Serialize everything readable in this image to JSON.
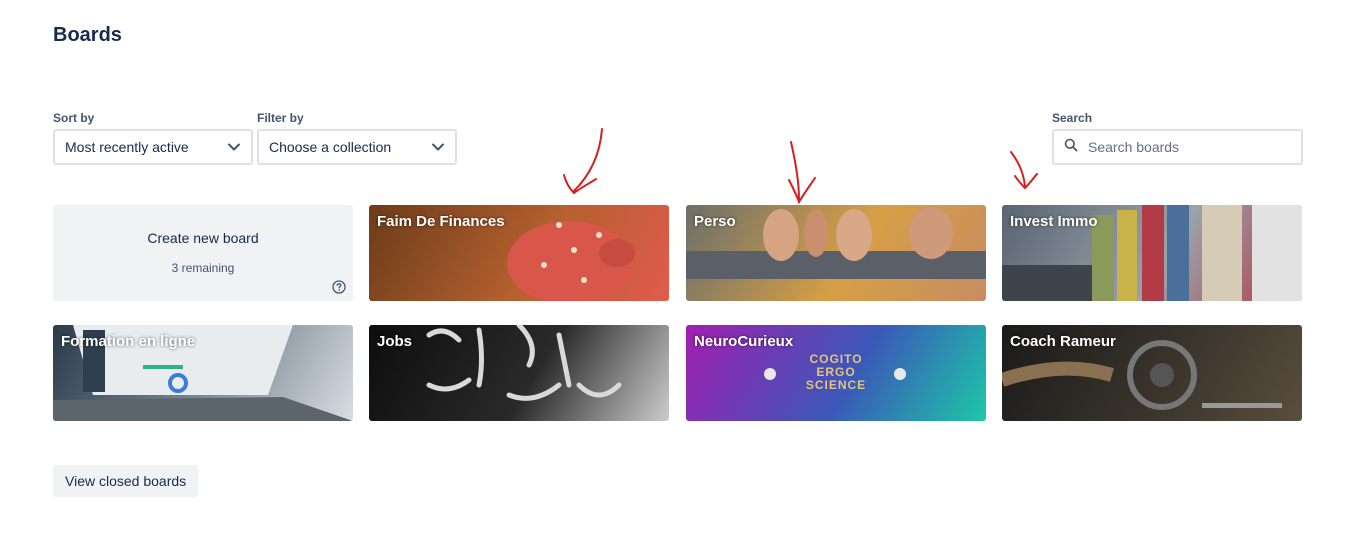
{
  "page": {
    "title": "Boards"
  },
  "controls": {
    "sort": {
      "label": "Sort by",
      "value": "Most recently active"
    },
    "filter": {
      "label": "Filter by",
      "value": "Choose a collection"
    },
    "search": {
      "label": "Search",
      "placeholder": "Search boards"
    }
  },
  "create_board": {
    "label": "Create new board",
    "remaining": "3 remaining"
  },
  "boards": [
    {
      "title": "Faim De Finances",
      "colors": [
        "#6b3c1a",
        "#b5602f",
        "#e15b4d"
      ]
    },
    {
      "title": "Perso",
      "colors": [
        "#6c6f6b",
        "#d69f45",
        "#c98c62"
      ]
    },
    {
      "title": "Invest Immo",
      "colors": [
        "#5a6472",
        "#9aa3ab",
        "#b23b45"
      ]
    },
    {
      "title": "Formation en ligne",
      "colors": [
        "#2b3b4a",
        "#7d8a96",
        "#d9dee3"
      ]
    },
    {
      "title": "Jobs",
      "colors": [
        "#0d0d0d",
        "#2a2a2a",
        "#cccccc"
      ]
    },
    {
      "title": "NeuroCurieux",
      "colors": [
        "#a21fb1",
        "#3b58b8",
        "#1dc7a8"
      ],
      "overlay_text": [
        "COGITO",
        "ERGO",
        "SCIENCE"
      ]
    },
    {
      "title": "Coach Rameur",
      "colors": [
        "#1b1b1b",
        "#3a342c",
        "#5a4e3c"
      ]
    }
  ],
  "footer": {
    "view_closed": "View closed boards"
  },
  "accent_colors": {
    "annotation": "#d62020",
    "tile_grey": "#f1f2f4",
    "border": "#dfe1e6"
  }
}
